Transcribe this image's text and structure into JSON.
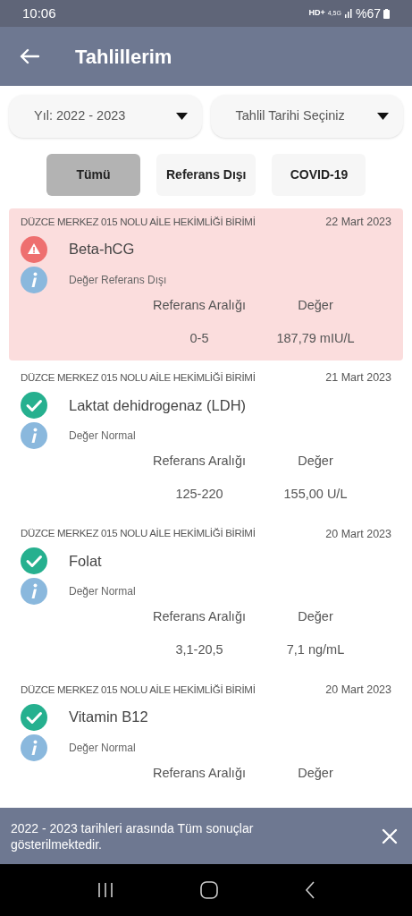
{
  "status_bar": {
    "time": "10:06",
    "network": "HD+",
    "mobile": "4,5G",
    "battery": "%67"
  },
  "app_bar": {
    "title": "Tahlillerim"
  },
  "filters": [
    {
      "value": "Yıl: 2022 - 2023"
    },
    {
      "value": "Tahlil Tarihi Seçiniz"
    }
  ],
  "chips": [
    {
      "label": "Tümü",
      "selected": true
    },
    {
      "label": "Referans Dışı",
      "selected": false
    },
    {
      "label": "COVID-19",
      "selected": false
    }
  ],
  "results": [
    {
      "clinic": "DÜZCE MERKEZ 015 NOLU AİLE HEKİMLİĞİ BİRİMİ",
      "date": "22 Mart 2023",
      "test": "Beta-hCG",
      "abnormal": true,
      "status_text": "Değer Referans Dışı",
      "range_label": "Referans Aralığı",
      "value_label": "Değer",
      "range": "0-5",
      "value": "187,79 mIU/L"
    },
    {
      "clinic": "DÜZCE MERKEZ 015 NOLU AİLE HEKİMLİĞİ BİRİMİ",
      "date": "21 Mart 2023",
      "test": "Laktat dehidrogenaz (LDH)",
      "abnormal": false,
      "status_text": "Değer Normal",
      "range_label": "Referans Aralığı",
      "value_label": "Değer",
      "range": "125-220",
      "value": "155,00 U/L"
    },
    {
      "clinic": "DÜZCE MERKEZ 015 NOLU AİLE HEKİMLİĞİ BİRİMİ",
      "date": "20 Mart 2023",
      "test": "Folat",
      "abnormal": false,
      "status_text": "Değer Normal",
      "range_label": "Referans Aralığı",
      "value_label": "Değer",
      "range": "3,1-20,5",
      "value": "7,1 ng/mL"
    },
    {
      "clinic": "DÜZCE MERKEZ 015 NOLU AİLE HEKİMLİĞİ BİRİMİ",
      "date": "20 Mart 2023",
      "test": "Vitamin B12",
      "abnormal": false,
      "status_text": "Değer Normal",
      "range_label": "Referans Aralığı",
      "value_label": "Değer"
    }
  ],
  "snackbar": {
    "message": "2022 - 2023 tarihleri arasında Tüm sonuçlar gösterilmektedir."
  }
}
